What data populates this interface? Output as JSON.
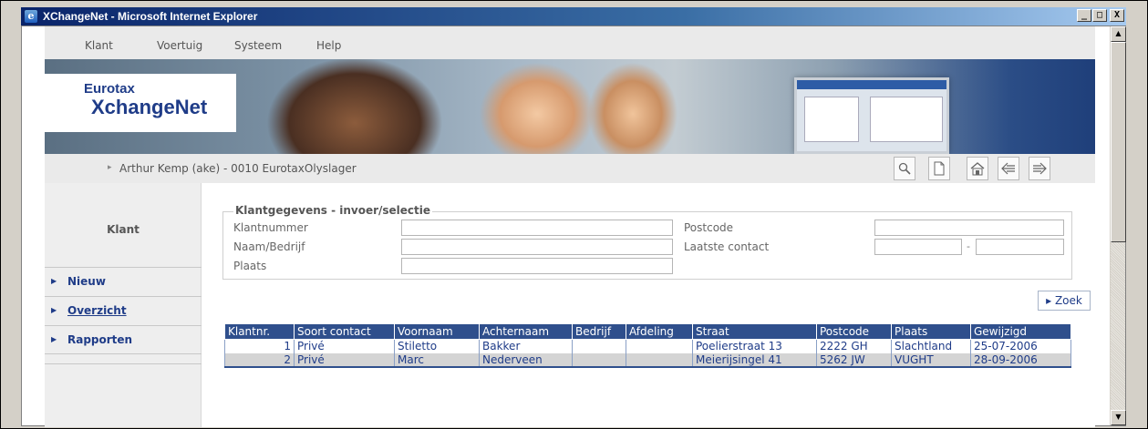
{
  "window": {
    "title": "XChangeNet - Microsoft Internet Explorer",
    "buttons": [
      "_",
      "□",
      "X"
    ]
  },
  "menu": {
    "items": [
      "Klant",
      "Voertuig",
      "Systeem",
      "Help"
    ]
  },
  "banner": {
    "logo_line1": "Eurotax",
    "logo_line2": "XchangeNet"
  },
  "userbar": {
    "arrow": "▸",
    "user": "Arthur Kemp (ake) - 0010 EurotaxOlyslager",
    "tools": [
      "search-icon",
      "new-document-icon",
      "home-icon",
      "back-arrow-icon",
      "forward-arrow-icon"
    ]
  },
  "sidebar": {
    "heading": "Klant",
    "items": [
      {
        "label": "Nieuw"
      },
      {
        "label": "Overzicht"
      },
      {
        "label": "Rapporten"
      }
    ]
  },
  "form": {
    "legend": "Klantgegevens - invoer/selectie",
    "klantnummer_label": "Klantnummer",
    "naam_label": "Naam/Bedrijf",
    "plaats_label": "Plaats",
    "postcode_label": "Postcode",
    "laatste_contact_label": "Laatste contact",
    "range_dash": "-",
    "klantnummer_value": "",
    "naam_value": "",
    "plaats_value": "",
    "postcode_value": "",
    "contact_from_value": "",
    "contact_to_value": "",
    "search_label": "▸ Zoek"
  },
  "results": {
    "columns": [
      "Klantnr.",
      "Soort contact",
      "Voornaam",
      "Achternaam",
      "Bedrijf",
      "Afdeling",
      "Straat",
      "Postcode",
      "Plaats",
      "Gewijzigd"
    ],
    "rows": [
      [
        "1",
        "Privé",
        "Stiletto",
        "Bakker",
        "",
        "",
        "Poelierstraat 13",
        "2222 GH",
        "Slachtland",
        "25-07-2006"
      ],
      [
        "2",
        "Privé",
        "Marc",
        "Nederveen",
        "",
        "",
        "Meierijsingel 41",
        "5262 JW",
        "VUGHT",
        "28-09-2006"
      ]
    ]
  },
  "colors": {
    "brand_blue": "#1f3c88",
    "table_header": "#2f4f8c",
    "menu_bg": "#eaeaea"
  }
}
